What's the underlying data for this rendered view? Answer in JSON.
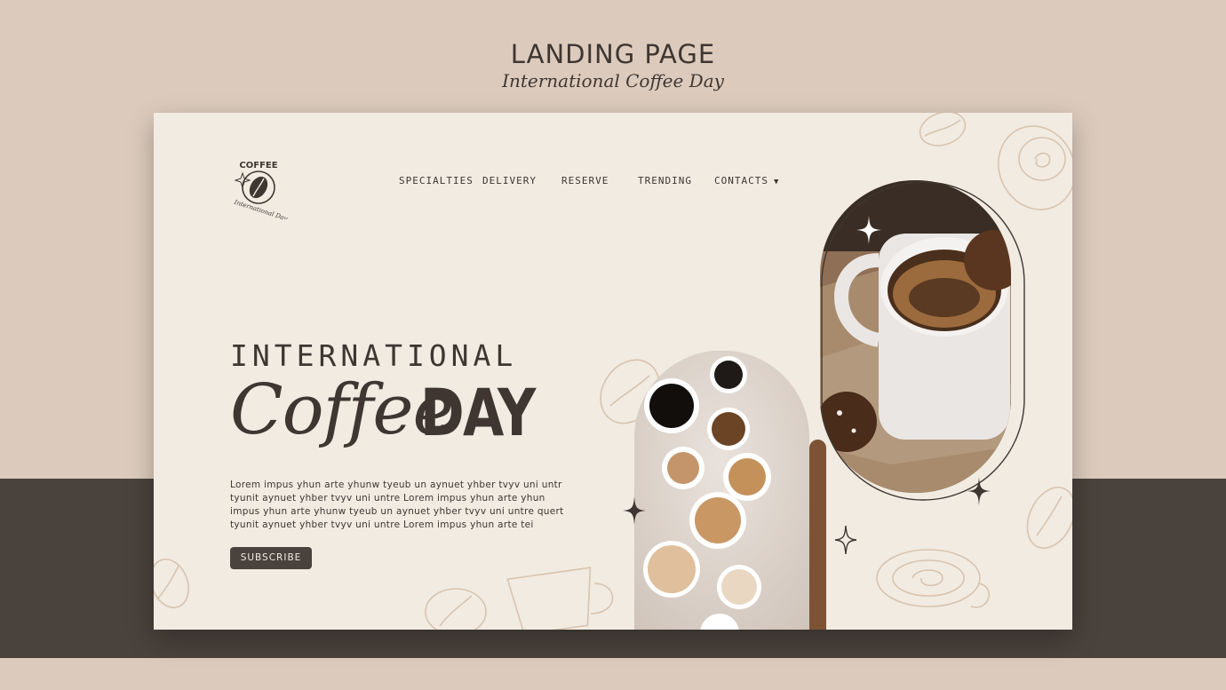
{
  "header": {
    "title": "LANDING PAGE",
    "subtitle": "International Coffee Day"
  },
  "logo": {
    "word": "COFFEE",
    "script": "International Day"
  },
  "nav": {
    "items": [
      {
        "label": "SPECIALTIES"
      },
      {
        "label": "DELIVERY"
      },
      {
        "label": "RESERVE"
      },
      {
        "label": "TRENDING"
      },
      {
        "label": "CONTACTS"
      }
    ],
    "dropdown_icon": "caret-down-icon"
  },
  "hero": {
    "line1": "INTERNATIONAL",
    "script": "Coffee",
    "bold": "DAY",
    "body_lines": [
      "Lorem impus yhun arte yhunw tyeub un aynuet yhber tvyv uni untr",
      "tyunit aynuet yhber tvyv uni untre Lorem impus yhun arte yhun",
      "impus yhun arte yhunw tyeub un aynuet yhber tvyv uni untre quert",
      "tyunit aynuet yhber tvyv uni untre Lorem impus yhun arte tei"
    ],
    "cta": "SUBSCRIBE"
  },
  "colors": {
    "background": "#dccbbd",
    "band": "#4a423c",
    "card": "#f1ebe2",
    "text": "#3f3631",
    "accent_brown": "#7d5235"
  }
}
